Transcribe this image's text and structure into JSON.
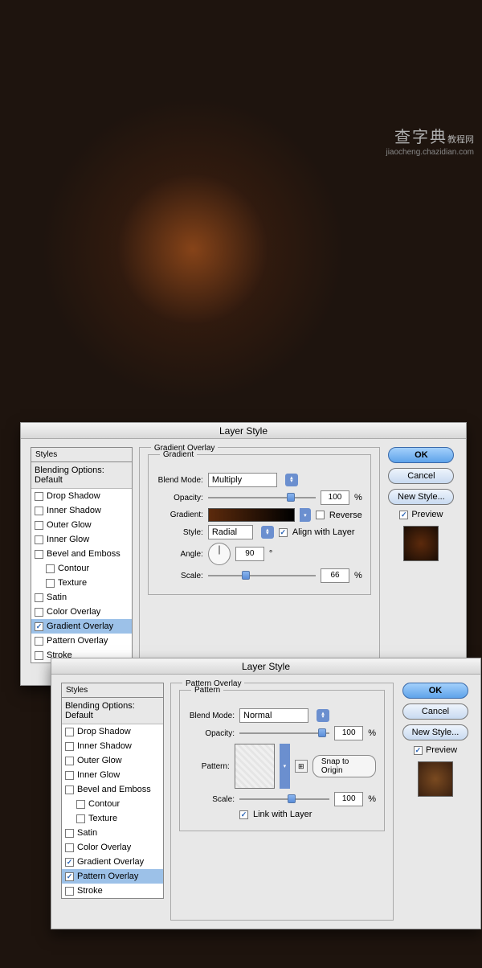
{
  "watermark": {
    "big": "查字典",
    "tag": "教程网",
    "small": "jiaocheng.chazidian.com"
  },
  "dialogTitle": "Layer Style",
  "stylesHeader": "Styles",
  "blendingOptions": "Blending Options: Default",
  "effects": {
    "dropShadow": "Drop Shadow",
    "innerShadow": "Inner Shadow",
    "outerGlow": "Outer Glow",
    "innerGlow": "Inner Glow",
    "bevelEmboss": "Bevel and Emboss",
    "contour": "Contour",
    "texture": "Texture",
    "satin": "Satin",
    "colorOverlay": "Color Overlay",
    "gradientOverlay": "Gradient Overlay",
    "patternOverlay": "Pattern Overlay",
    "stroke": "Stroke"
  },
  "buttons": {
    "ok": "OK",
    "cancel": "Cancel",
    "newStyle": "New Style...",
    "preview": "Preview",
    "snapOrigin": "Snap to Origin"
  },
  "gradOverlay": {
    "panel": "Gradient Overlay",
    "sub": "Gradient",
    "blendModeLbl": "Blend Mode:",
    "blendMode": "Multiply",
    "opacityLbl": "Opacity:",
    "opacity": "100",
    "pct": "%",
    "gradientLbl": "Gradient:",
    "reverse": "Reverse",
    "styleLbl": "Style:",
    "style": "Radial",
    "align": "Align with Layer",
    "angleLbl": "Angle:",
    "angle": "90",
    "deg": "°",
    "scaleLbl": "Scale:",
    "scale": "66"
  },
  "patOverlay": {
    "panel": "Pattern Overlay",
    "sub": "Pattern",
    "blendModeLbl": "Blend Mode:",
    "blendMode": "Normal",
    "opacityLbl": "Opacity:",
    "opacity": "100",
    "pct": "%",
    "patternLbl": "Pattern:",
    "scaleLbl": "Scale:",
    "scale": "100",
    "link": "Link with Layer"
  }
}
